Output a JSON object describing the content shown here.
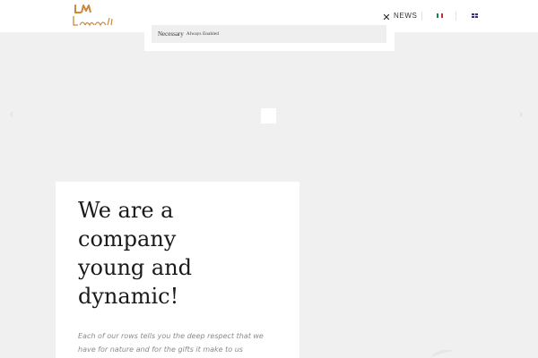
{
  "header": {
    "logo_text": "Lazzarotti",
    "nav_news": "NEWS",
    "flags": [
      "it-flag-icon",
      "en-flag-icon"
    ]
  },
  "cookie": {
    "title": "Necessary",
    "status": "Always Enabled",
    "close_icon": "close-icon"
  },
  "slider": {
    "prev_icon": "chevron-left-icon",
    "next_icon": "chevron-right-icon"
  },
  "card": {
    "title_lines": [
      "We are a",
      "company",
      "young and",
      "dynamic!"
    ],
    "text": "Each of our rows tells you the deep respect that we have for nature and for the gifts it make to us"
  },
  "colors": {
    "accent": "#c98a3c",
    "background": "#f0f0f0"
  }
}
